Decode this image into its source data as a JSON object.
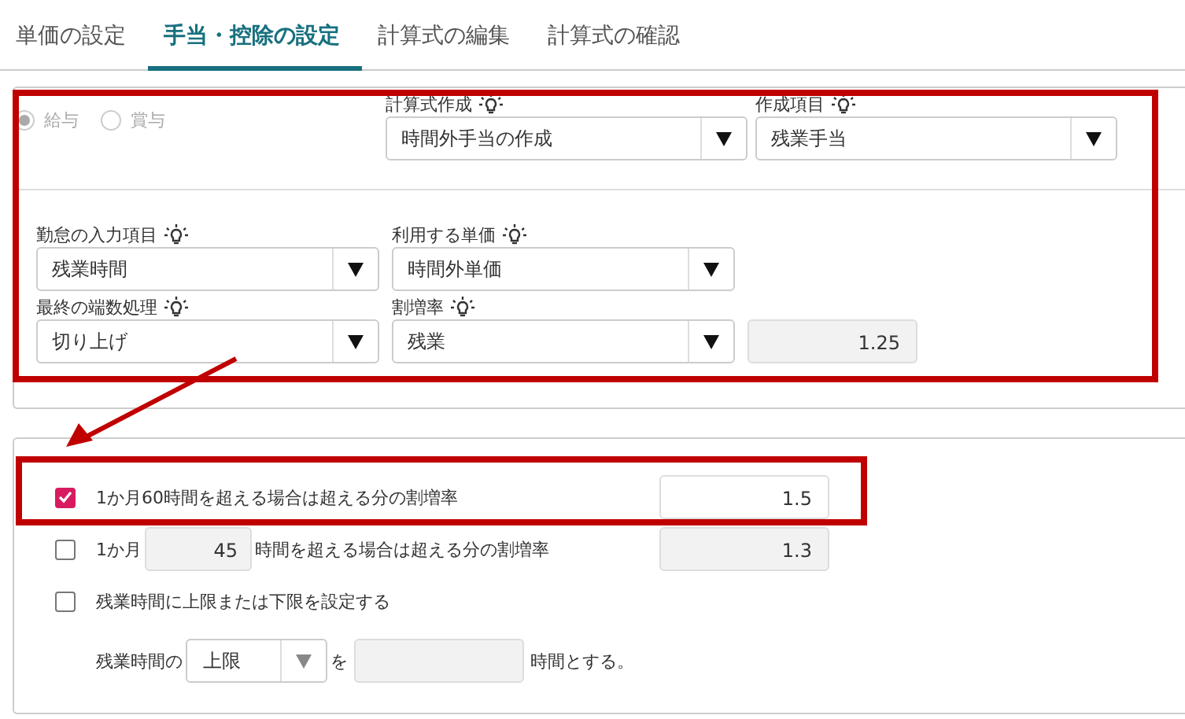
{
  "tabs": [
    {
      "label": "単価の設定",
      "selected": false
    },
    {
      "label": "手当・控除の設定",
      "selected": true
    },
    {
      "label": "計算式の編集",
      "selected": false
    },
    {
      "label": "計算式の確認",
      "selected": false
    }
  ],
  "settings_panel": {
    "highlighted": true,
    "pay_types": [
      {
        "label": "給与",
        "selected": true
      },
      {
        "label": "賞与",
        "selected": false
      }
    ],
    "pay_types_disabled": true,
    "formula_fields": [
      {
        "label": "計算式作成",
        "value": "時間外手当の作成"
      },
      {
        "label": "作成項目",
        "value": "残業手当"
      }
    ],
    "input_fields": [
      {
        "label": "勤怠の入力項目",
        "value": "残業時間"
      },
      {
        "label": "利用する単価",
        "value": "時間外単価"
      },
      {
        "label": "最終の端数処理",
        "value": "切り上げ"
      },
      {
        "label": "割増率",
        "value": "残業"
      }
    ],
    "rate": "1.25"
  },
  "options": [
    {
      "kind": "fixed",
      "checked": true,
      "highlighted": true,
      "text": "1か月60時間を超える場合は超える分の割増率",
      "rate": "1.5"
    },
    {
      "kind": "custom",
      "checked": false,
      "highlighted": false,
      "prefix": "1か月",
      "hours": "45",
      "suffix": "時間を超える場合は超える分の割増率",
      "rate": "1.3"
    },
    {
      "kind": "limit",
      "checked": false,
      "highlighted": false,
      "text": "残業時間に上限または下限を設定する"
    }
  ],
  "limit_row": {
    "prefix": "残業時間の",
    "select": "上限",
    "middle": "を",
    "suffix": "時間とする。"
  }
}
